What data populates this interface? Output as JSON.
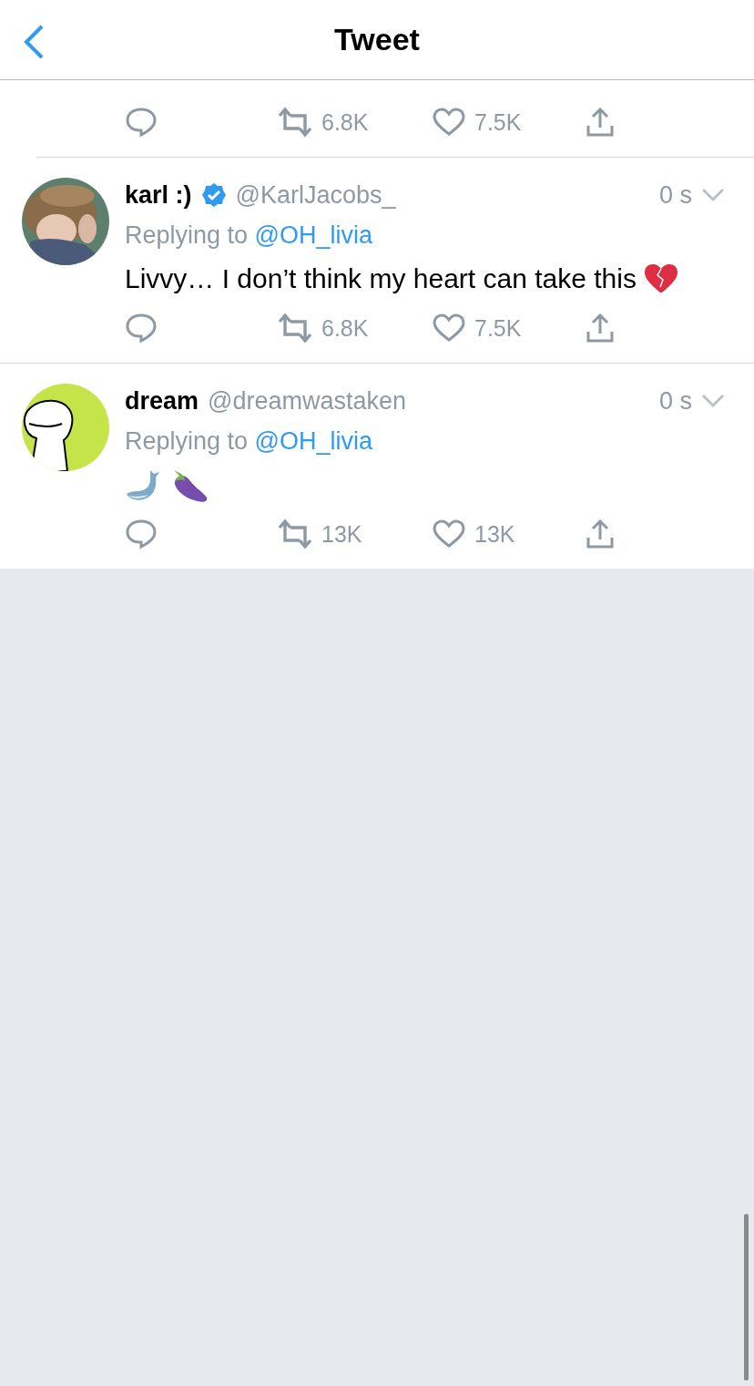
{
  "header": {
    "title": "Tweet"
  },
  "top_actions": {
    "retweets": "6.8K",
    "likes": "7.5K"
  },
  "replies": [
    {
      "name": "karl :)",
      "verified": true,
      "handle": "@KarlJacobs_",
      "time": "0 s",
      "replying_label": "Replying to",
      "replying_to": "@OH_livia",
      "text": "Livvy… I don’t think my heart can take this",
      "retweets": "6.8K",
      "likes": "7.5K"
    },
    {
      "name": "dream",
      "verified": false,
      "handle": "@dreamwastaken",
      "time": "0 s",
      "replying_label": "Replying to",
      "replying_to": "@OH_livia",
      "retweets": "13K",
      "likes": "13K"
    }
  ]
}
